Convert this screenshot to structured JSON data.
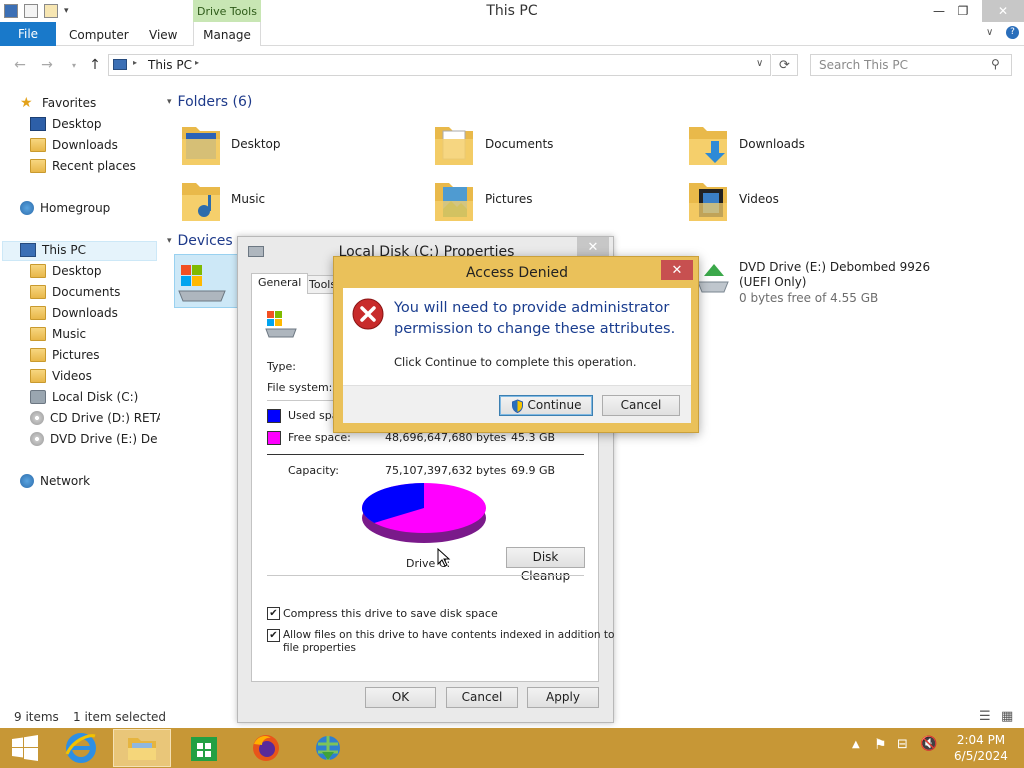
{
  "window": {
    "title": "This PC",
    "context_tab": "Drive Tools"
  },
  "ribbon": {
    "tabs": [
      "File",
      "Computer",
      "View",
      "Manage"
    ]
  },
  "address": {
    "path": "This PC",
    "search_placeholder": "Search This PC"
  },
  "nav": {
    "favorites": {
      "label": "Favorites",
      "items": [
        "Desktop",
        "Downloads",
        "Recent places"
      ]
    },
    "homegroup": "Homegroup",
    "thispc": {
      "label": "This PC",
      "items": [
        "Desktop",
        "Documents",
        "Downloads",
        "Music",
        "Pictures",
        "Videos",
        "Local Disk (C:)",
        "CD Drive (D:) RETAP",
        "DVD Drive (E:) Debor"
      ]
    },
    "network": "Network"
  },
  "content": {
    "folders_header": "Folders (6)",
    "folders": [
      "Desktop",
      "Documents",
      "Downloads",
      "Music",
      "Pictures",
      "Videos"
    ],
    "devices_header": "Devices",
    "dvd": {
      "name": "DVD Drive (E:) Debombed 9926",
      "name2": "(UEFI Only)",
      "free": "0 bytes free of 4.55 GB"
    }
  },
  "status": {
    "items": "9 items",
    "selected": "1 item selected"
  },
  "props": {
    "title": "Local Disk (C:) Properties",
    "tabs": [
      "General",
      "Tools"
    ],
    "type_label": "Type:",
    "fs_label": "File system:",
    "used_label": "Used space",
    "free_label": "Free space:",
    "free_bytes": "48,696,647,680 bytes",
    "free_gb": "45.3 GB",
    "capacity_label": "Capacity:",
    "capacity_bytes": "75,107,397,632 bytes",
    "capacity_gb": "69.9 GB",
    "drive_label": "Drive C:",
    "disk_cleanup": "Disk Cleanup",
    "compress": "Compress this drive to save disk space",
    "index": "Allow files on this drive to have contents indexed in addition to",
    "index2": "file properties",
    "ok": "OK",
    "cancel": "Cancel",
    "apply": "Apply",
    "used_color": "#0000ff",
    "free_color": "#ff00ff",
    "free_fraction": 0.648
  },
  "denied": {
    "title": "Access Denied",
    "msg1": "You will need to provide administrator",
    "msg2": "permission to change these attributes.",
    "sub": "Click Continue to complete this operation.",
    "continue": "Continue",
    "cancel": "Cancel"
  },
  "clock": {
    "time": "2:04 PM",
    "date": "6/5/2024"
  }
}
